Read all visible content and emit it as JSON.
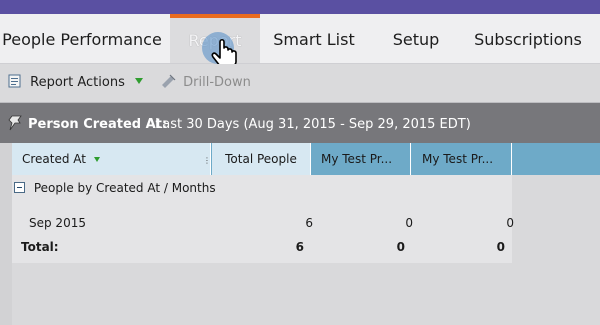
{
  "tabs": [
    {
      "label": "People Performance",
      "active": false
    },
    {
      "label": "Report",
      "active": true
    },
    {
      "label": "Smart List",
      "active": false
    },
    {
      "label": "Setup",
      "active": false
    },
    {
      "label": "Subscriptions",
      "active": false
    }
  ],
  "toolbar": {
    "report_actions_label": "Report Actions",
    "drill_down_label": "Drill-Down"
  },
  "criteria": {
    "label": "Person Created At:",
    "value": "Last 30 Days (Aug 31, 2015 - Sep 29, 2015 EDT)"
  },
  "grid": {
    "columns": [
      "Created At",
      "Total People",
      "My Test Pr...",
      "My Test Pr..."
    ],
    "group_label": "People by Created At / Months",
    "rows": [
      {
        "label": "Sep 2015",
        "values": [
          "6",
          "0",
          "0"
        ]
      }
    ],
    "total": {
      "label": "Total:",
      "values": [
        "6",
        "0",
        "0"
      ]
    }
  },
  "colors": {
    "accent_tab_border": "#e96b1f",
    "header_blue": "#6eaac8",
    "brand_bar": "#5a50a2"
  },
  "icons": [
    "report-actions-icon",
    "drill-down-icon",
    "pin-icon",
    "hand-cursor-icon"
  ]
}
